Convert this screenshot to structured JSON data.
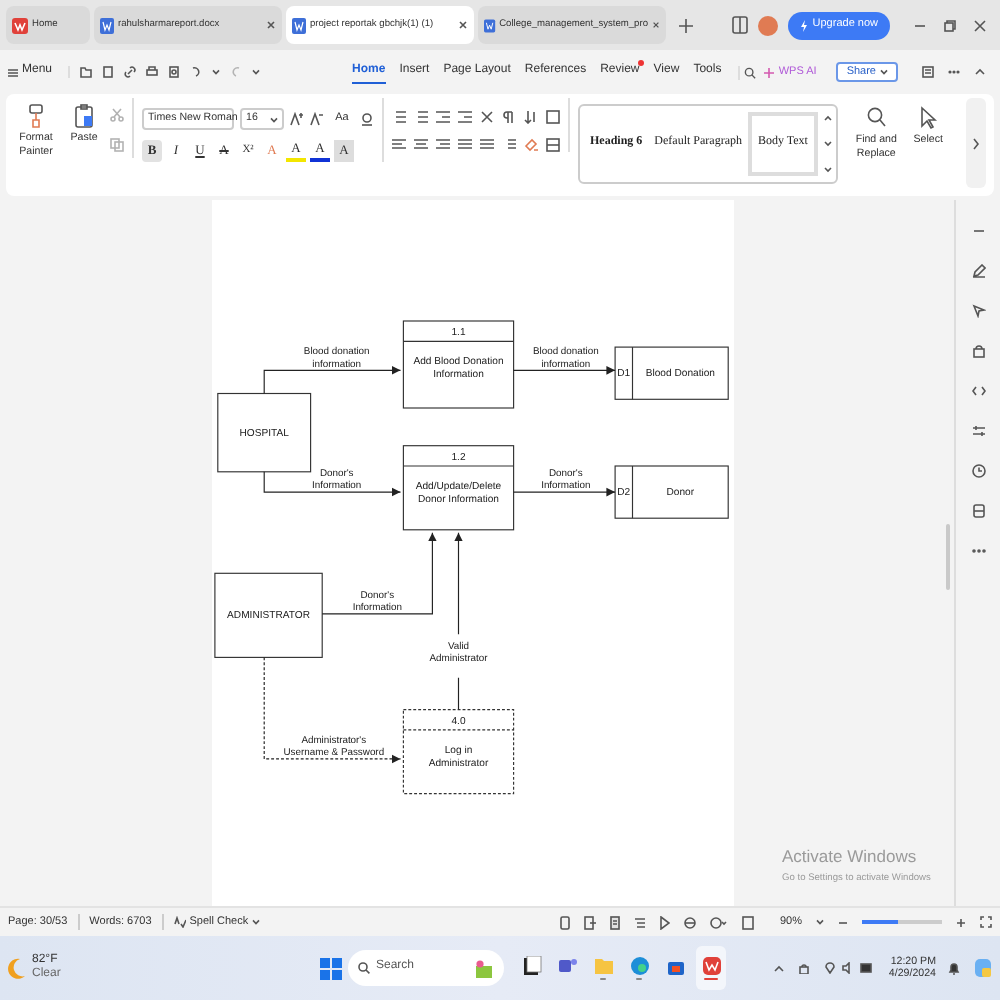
{
  "tabs": [
    {
      "label": "Home",
      "kind": "home",
      "selected": false
    },
    {
      "label": "rahulsharmareport.docx",
      "kind": "doc",
      "selected": false
    },
    {
      "label": "project reportak gbchjk(1) (1)",
      "kind": "doc",
      "selected": true
    },
    {
      "label": "College_management_system_pro",
      "kind": "doc",
      "selected": false
    }
  ],
  "upgrade_button": "Upgrade now",
  "menu_bar": {
    "menu": "Menu",
    "tabs": [
      {
        "label": "Home",
        "selected": true,
        "notify": false
      },
      {
        "label": "Insert",
        "selected": false,
        "notify": false
      },
      {
        "label": "Page Layout",
        "selected": false,
        "notify": false
      },
      {
        "label": "References",
        "selected": false,
        "notify": false
      },
      {
        "label": "Review",
        "selected": false,
        "notify": true
      },
      {
        "label": "View",
        "selected": false,
        "notify": false
      },
      {
        "label": "Tools",
        "selected": false,
        "notify": false
      }
    ],
    "ai": "WPS AI",
    "share": "Share"
  },
  "ribbon": {
    "format_painter": "Format Painter",
    "paste": "Paste",
    "font": "Times New Roman",
    "size": "16",
    "change_case": "Aa",
    "format_buttons": [
      {
        "label": "B",
        "kind": "bold",
        "selected": true
      },
      {
        "label": "I",
        "kind": "italic",
        "selected": false
      },
      {
        "label": "U",
        "kind": "underline",
        "selected": false
      },
      {
        "label": "A",
        "kind": "strike",
        "selected": false
      },
      {
        "label": "X²",
        "kind": "super",
        "selected": false
      },
      {
        "label": "A",
        "kind": "effect",
        "selected": false
      },
      {
        "label": "A",
        "kind": "highlight",
        "selected": false
      },
      {
        "label": "A",
        "kind": "color",
        "selected": false
      },
      {
        "label": "A",
        "kind": "shade",
        "selected": false
      }
    ],
    "styles": [
      {
        "label": "Heading 6",
        "selected": false
      },
      {
        "label": "Default Paragraph",
        "selected": false
      },
      {
        "label": "Body Text",
        "selected": true
      }
    ],
    "find": "Find and Replace",
    "select": "Select"
  },
  "diagram": {
    "entities": [
      {
        "label": "HOSPITAL"
      },
      {
        "label": "ADMINISTRATOR"
      }
    ],
    "processes": [
      {
        "number": "1.1",
        "lines": [
          "Add Blood Donation",
          "Information"
        ],
        "dashed": false
      },
      {
        "number": "1.2",
        "lines": [
          "Add/Update/Delete",
          "Donor Information"
        ],
        "dashed": false
      },
      {
        "number": "4.0",
        "lines": [
          "Log in",
          "Administrator"
        ],
        "dashed": true
      }
    ],
    "stores": [
      {
        "id": "D1",
        "label": "Blood Donation"
      },
      {
        "id": "D2",
        "label": "Donor"
      }
    ],
    "flows": [
      {
        "lines": [
          "Blood donation",
          "information"
        ],
        "dashed": false
      },
      {
        "lines": [
          "Blood donation",
          "information"
        ],
        "dashed": false
      },
      {
        "lines": [
          "Donor's",
          "Information"
        ],
        "dashed": false
      },
      {
        "lines": [
          "Donor's",
          "Information"
        ],
        "dashed": false
      },
      {
        "lines": [
          "Donor's",
          "Information"
        ],
        "dashed": false
      },
      {
        "lines": [
          "Valid",
          "Administrator"
        ],
        "dashed": false
      },
      {
        "lines": [
          "Administrator's",
          "Username & Password"
        ],
        "dashed": true
      }
    ]
  },
  "activation": {
    "title": "Activate Windows",
    "subtitle": "Go to Settings to activate Windows"
  },
  "status_bar": {
    "page": "Page: 30/53",
    "words": "Words: 6703",
    "spell_check": "Spell Check",
    "zoom": "90%",
    "zoom_slider": {
      "level": 0.45
    }
  },
  "taskbar": {
    "weather": {
      "temp": "82°F",
      "condition": "Clear"
    },
    "search_placeholder": "Search",
    "apps": [
      {
        "kind": "files",
        "running": false,
        "active": false
      },
      {
        "kind": "teams",
        "running": false,
        "active": false
      },
      {
        "kind": "folder",
        "running": true,
        "active": false
      },
      {
        "kind": "edge",
        "running": true,
        "active": false
      },
      {
        "kind": "store",
        "running": false,
        "active": false
      },
      {
        "kind": "wps",
        "running": true,
        "active": true
      }
    ],
    "time": "12:20 PM",
    "date": "4/29/2024"
  }
}
